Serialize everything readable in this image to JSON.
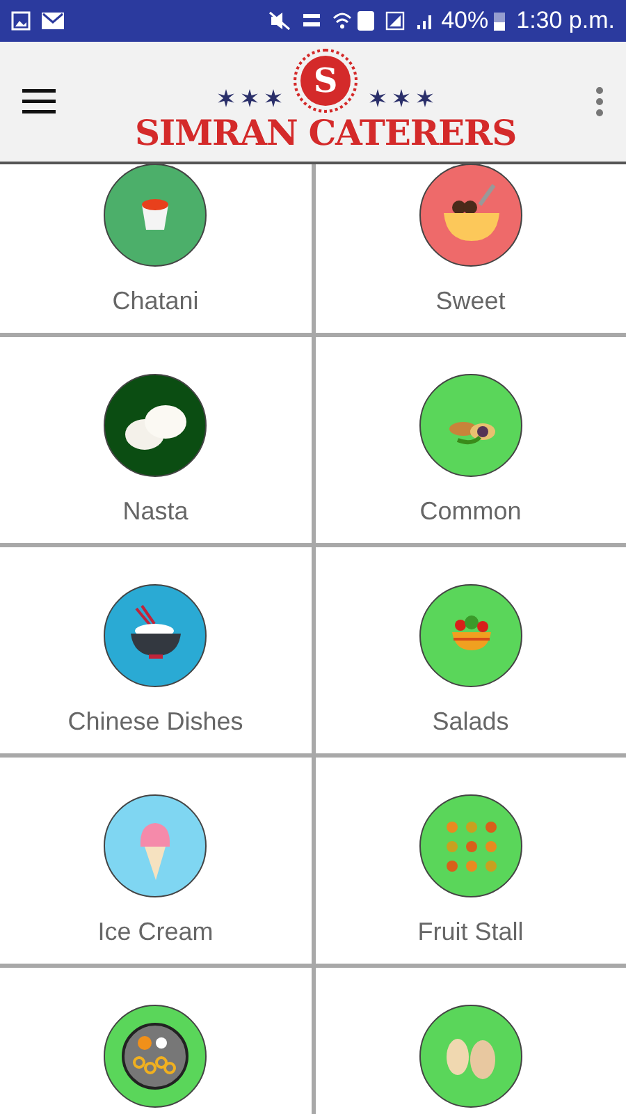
{
  "status_bar": {
    "battery": "40%",
    "time": "1:30 p.m."
  },
  "header": {
    "logo_letter": "S",
    "title": "SIMRAN CATERERS"
  },
  "categories": [
    {
      "label": "Chatani",
      "color": "#4caf6a",
      "kind": "sauce"
    },
    {
      "label": "Sweet",
      "color": "#ee6a6a",
      "kind": "bowl"
    },
    {
      "label": "Nasta",
      "color": "#0b4d12",
      "kind": "idli"
    },
    {
      "label": "Common",
      "color": "#5ad65a",
      "kind": "platter"
    },
    {
      "label": "Chinese Dishes",
      "color": "#2aaad4",
      "kind": "rice"
    },
    {
      "label": "Salads",
      "color": "#5ad65a",
      "kind": "salad"
    },
    {
      "label": "Ice Cream",
      "color": "#7fd6f2",
      "kind": "icecream"
    },
    {
      "label": "Fruit Stall",
      "color": "#5ad65a",
      "kind": "fruits"
    },
    {
      "color": "#5ad65a",
      "kind": "thali"
    },
    {
      "color": "#5ad65a",
      "kind": "pastry"
    }
  ]
}
